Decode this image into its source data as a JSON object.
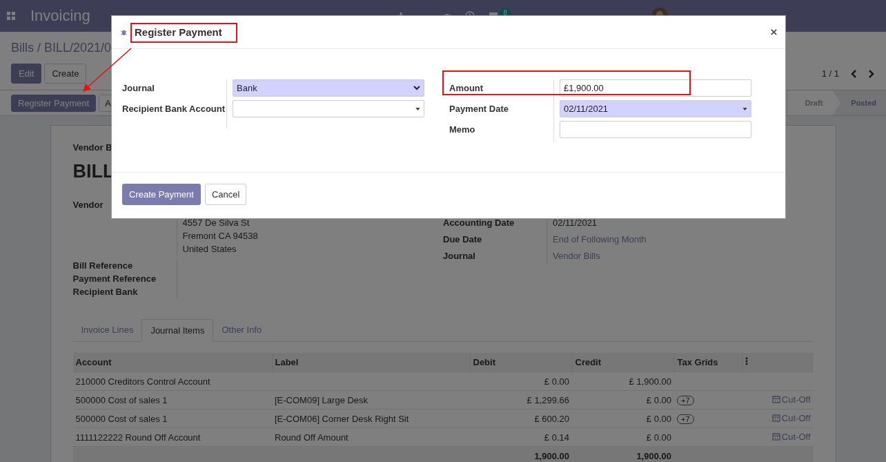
{
  "navbar": {
    "app_title": "Invoicing",
    "chat_count": "8"
  },
  "breadcrumb": "Bills / BILL/2021/0",
  "buttons": [
    {
      "label": "Edit",
      "kind": "primary"
    },
    {
      "label": "Create",
      "kind": "secondary"
    }
  ],
  "pager": "1 / 1",
  "status_buttons": [
    {
      "label": "Register Payment",
      "kind": "primary"
    },
    {
      "label": "A",
      "kind": "secondary"
    }
  ],
  "stages": [
    {
      "label": "Draft",
      "selected": false
    },
    {
      "label": "Posted",
      "selected": true
    }
  ],
  "sheet": {
    "doc_type": "Vendor B",
    "name": "BILL",
    "left_fields": [
      {
        "label": "Vendor",
        "lines": [
          "4557 De Silva St",
          "Fremont CA 94538",
          "United States"
        ]
      },
      {
        "label": "Bill Reference"
      },
      {
        "label": "Payment Reference"
      },
      {
        "label": "Recipient Bank"
      }
    ],
    "right_fields": [
      {
        "label": "Accounting Date",
        "value": "02/11/2021",
        "kind": "text"
      },
      {
        "label": "Due Date",
        "value": "End of Following Month",
        "kind": "link"
      },
      {
        "label": "Journal",
        "value": "Vendor Bills",
        "kind": "link"
      }
    ]
  },
  "tabs": [
    {
      "label": "Invoice Lines",
      "selected": false
    },
    {
      "label": "Journal Items",
      "selected": true
    },
    {
      "label": "Other Info",
      "selected": false
    }
  ],
  "table": {
    "columns": [
      "Account",
      "Label",
      "Debit",
      "Credit",
      "Tax Grids"
    ],
    "rows": [
      {
        "account": "210000 Creditors Control Account",
        "label": "",
        "debit": "£ 0.00",
        "credit": "£ 1,900.00",
        "tax_grid": "",
        "cutoff": ""
      },
      {
        "account": "500000 Cost of sales 1",
        "label": "[E-COM09] Large Desk",
        "debit": "£ 1,299.66",
        "credit": "£ 0.00",
        "tax_grid": "+7",
        "cutoff": "Cut-Off"
      },
      {
        "account": "500000 Cost of sales 1",
        "label": "[E-COM06] Corner Desk Right Sit",
        "debit": "£ 600.20",
        "credit": "£ 0.00",
        "tax_grid": "+7",
        "cutoff": "Cut-Off"
      },
      {
        "account": "1111122222 Round Off Account",
        "label": "Round Off Amount",
        "debit": "£ 0.14",
        "credit": "£ 0.00",
        "tax_grid": "",
        "cutoff": "Cut-Off"
      }
    ],
    "totals": {
      "debit": "1,900.00",
      "credit": "1,900.00"
    }
  },
  "dialog": {
    "title": "Register Payment",
    "left_fields": [
      {
        "label": "Journal",
        "value": "Bank",
        "kind": "native-select",
        "required": true
      },
      {
        "label": "Recipient Bank Account",
        "kind": "select",
        "required": false
      }
    ],
    "right_fields": [
      {
        "label": "Amount",
        "value": "£1,900.00",
        "kind": "input",
        "required": false
      },
      {
        "label": "Payment Date",
        "value": "02/11/2021",
        "kind": "select",
        "required": true
      },
      {
        "label": "Memo",
        "kind": "input",
        "required": false
      }
    ],
    "buttons": [
      {
        "label": "Create Payment",
        "kind": "primary"
      },
      {
        "label": "Cancel",
        "kind": "secondary"
      }
    ]
  }
}
